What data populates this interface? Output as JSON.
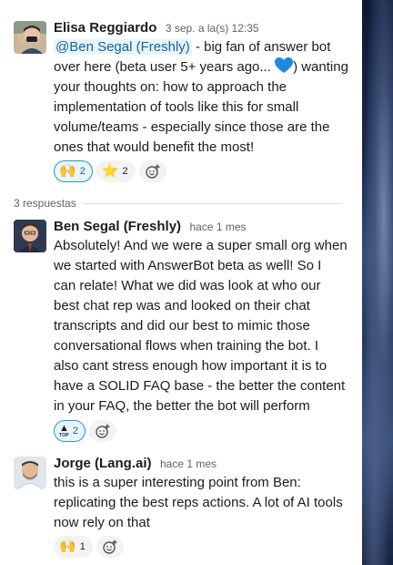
{
  "thread": {
    "parent": {
      "author": "Elisa Reggiardo",
      "timestamp": "3 sep. a la(s) 12:35",
      "mention": "@Ben Segal (Freshly)",
      "text_lines": [
        " - big fan of answer bot",
        "over here (beta user 5+ years ago... ",
        ") wanting",
        "your thoughts on: how to approach the",
        "implementation of tools like this for small",
        "volume/teams - especially since those are the",
        "ones that would benefit the most!"
      ],
      "heart_icon": "blue-heart-emoji",
      "reactions": [
        {
          "emoji": "🙌",
          "count": "2",
          "active": true
        },
        {
          "emoji": "⭐",
          "count": "2",
          "active": false
        }
      ]
    },
    "replies_label": "3 respuestas",
    "replies": [
      {
        "author": "Ben Segal (Freshly)",
        "timestamp": "hace 1 mes",
        "lines": [
          "Absolutely!  And we were a super small org when",
          "we started with AnswerBot beta as well!  So I",
          "can relate!  What we did was look at who our",
          "best chat rep was and looked on their chat",
          "transcripts and did our best to mimic those",
          "conversational flows when training the bot.  I",
          "also cant stress enough how important it is to",
          "have a SOLID FAQ base - the better the content",
          "in your FAQ, the better the bot will perform"
        ],
        "reactions": [
          {
            "emoji": "top-arrow",
            "label": "TOP",
            "count": "2",
            "active": true
          }
        ]
      },
      {
        "author": "Jorge (Lang.ai)",
        "timestamp": "hace 1 mes",
        "lines": [
          "this is a super interesting point from Ben:",
          "replicating the best reps actions. A lot of AI tools",
          "now rely on that"
        ],
        "reactions": [
          {
            "emoji": "🙌",
            "count": "1",
            "active": false
          }
        ]
      }
    ]
  },
  "icons": {
    "add_reaction": "add-reaction-icon"
  },
  "colors": {
    "mention": "#1264a3",
    "active_reaction_border": "#1d9bd1",
    "heart": "#1e88e5"
  }
}
